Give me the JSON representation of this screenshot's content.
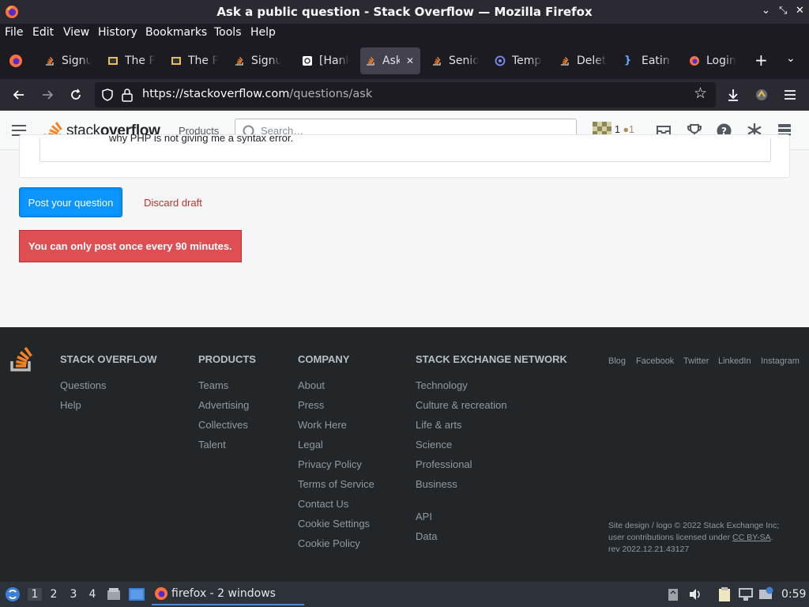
{
  "window": {
    "title": "Ask a public question - Stack Overflow — Mozilla Firefox",
    "controls": [
      "minimize",
      "maximize",
      "close"
    ]
  },
  "menubar": [
    "File",
    "Edit",
    "View",
    "History",
    "Bookmarks",
    "Tools",
    "Help"
  ],
  "tabs": [
    {
      "label": "Signu",
      "icon": "stackoverflow-favicon"
    },
    {
      "label": "The P",
      "icon": "film-favicon"
    },
    {
      "label": "The P",
      "icon": "film-favicon"
    },
    {
      "label": "Signu",
      "icon": "stackoverflow-favicon"
    },
    {
      "label": "[Hank",
      "icon": "q-favicon"
    },
    {
      "label": "Ask",
      "icon": "stackoverflow-favicon",
      "active": true
    },
    {
      "label": "Senio",
      "icon": "stackoverflow-favicon"
    },
    {
      "label": "Temp",
      "icon": "at-favicon"
    },
    {
      "label": "Delet",
      "icon": "stackoverflow-favicon"
    },
    {
      "label": "Eatin",
      "icon": "braces-favicon"
    },
    {
      "label": "Login",
      "icon": "firefox-favicon"
    }
  ],
  "navbar": {
    "url_host": "https://stackoverflow.com",
    "url_path": "/questions/ask"
  },
  "so_header": {
    "logo_text_light": "stack",
    "logo_text_bold": "overflow",
    "products_label": "Products",
    "search_placeholder": "Search…",
    "rep": "1",
    "bronze": "1"
  },
  "main": {
    "truncated_text": "why PHP is not giving me a syntax error.",
    "post_button": "Post your question",
    "discard_button": "Discard draft",
    "error_message": "You can only post once every 90 minutes."
  },
  "footer": {
    "columns": [
      {
        "title": "STACK OVERFLOW",
        "links": [
          "Questions",
          "Help"
        ]
      },
      {
        "title": "PRODUCTS",
        "links": [
          "Teams",
          "Advertising",
          "Collectives",
          "Talent"
        ]
      },
      {
        "title": "COMPANY",
        "links": [
          "About",
          "Press",
          "Work Here",
          "Legal",
          "Privacy Policy",
          "Terms of Service",
          "Contact Us",
          "Cookie Settings",
          "Cookie Policy"
        ]
      },
      {
        "title": "STACK EXCHANGE NETWORK",
        "links": [
          "Technology",
          "Culture & recreation",
          "Life & arts",
          "Science",
          "Professional",
          "Business"
        ],
        "extra_links": [
          "API",
          "Data"
        ]
      }
    ],
    "social": [
      "Blog",
      "Facebook",
      "Twitter",
      "LinkedIn",
      "Instagram"
    ],
    "legal_line1": "Site design / logo © 2022 Stack Exchange Inc;",
    "legal_line2_prefix": "user contributions licensed under ",
    "legal_license": "CC BY-SA",
    "legal_line2_suffix": ".",
    "legal_line3": "rev 2022.12.21.43127"
  },
  "taskbar": {
    "workspaces": [
      "1",
      "2",
      "3",
      "4"
    ],
    "active_workspace": "1",
    "app_label": "firefox - 2 windows",
    "clock": "0:59"
  },
  "colors": {
    "so_orange": "#f48225",
    "so_blue": "#0a95ff",
    "error_red": "#de4f54",
    "discard_red": "#c22e32"
  }
}
